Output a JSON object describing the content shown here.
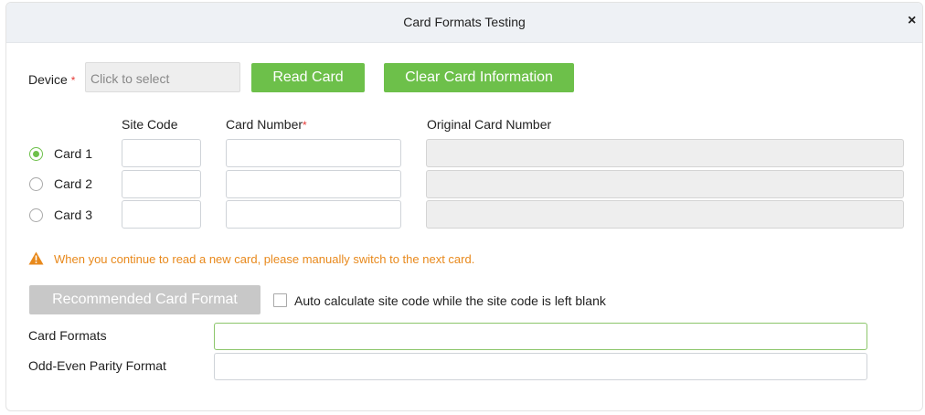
{
  "dialog": {
    "title": "Card Formats Testing",
    "close_glyph": "×"
  },
  "device": {
    "label": "Device",
    "required_mark": "*",
    "placeholder": "Click to select"
  },
  "buttons": {
    "read_card": "Read Card",
    "clear_card": "Clear Card Information",
    "recommended_format": "Recommended Card Format"
  },
  "table": {
    "headers": {
      "site_code": "Site Code",
      "card_number": "Card Number",
      "card_number_required": "*",
      "original_card_number": "Original Card Number"
    },
    "rows": [
      {
        "label": "Card 1",
        "selected": true
      },
      {
        "label": "Card 2",
        "selected": false
      },
      {
        "label": "Card 3",
        "selected": false
      }
    ]
  },
  "warning": {
    "icon": "warning-triangle-icon",
    "text": "When you continue to read a new card, please manually switch to the next card."
  },
  "auto_calc": {
    "label": "Auto calculate site code while the site code is left blank",
    "checked": false
  },
  "fields": {
    "card_formats_label": "Card Formats",
    "card_formats_value": "",
    "parity_label": "Odd-Even Parity Format",
    "parity_value": ""
  },
  "colors": {
    "accent_green": "#6dc04a",
    "warning_orange": "#e8891c",
    "required_red": "#e53935",
    "disabled_gray": "#c8c8c8"
  }
}
